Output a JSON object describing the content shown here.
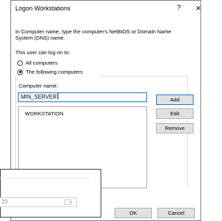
{
  "dialog": {
    "title": "Logon Workstations",
    "help_label": "?",
    "close_label": "×",
    "instructions": "In Computer name, type the computer's NetBIOS or Domain Name System (DNS) name.",
    "logon_to_label": "This user can log on to:",
    "radio_options": [
      {
        "label": "All computers",
        "selected": false
      },
      {
        "label": "The following computers",
        "selected": true
      }
    ],
    "computer_name_label": "Computer name:",
    "computer_name_value": "MIN_SERVER",
    "computers": [
      "WORKSTATION"
    ],
    "buttons": {
      "add": "Add",
      "edit": "Edit",
      "remove": "Remove",
      "ok": "OK",
      "cancel": "Cancel"
    }
  },
  "background_window": {
    "field_value": "20"
  },
  "colors": {
    "focus_border": "#0078d7",
    "button_bg": "#e1e1e1"
  }
}
